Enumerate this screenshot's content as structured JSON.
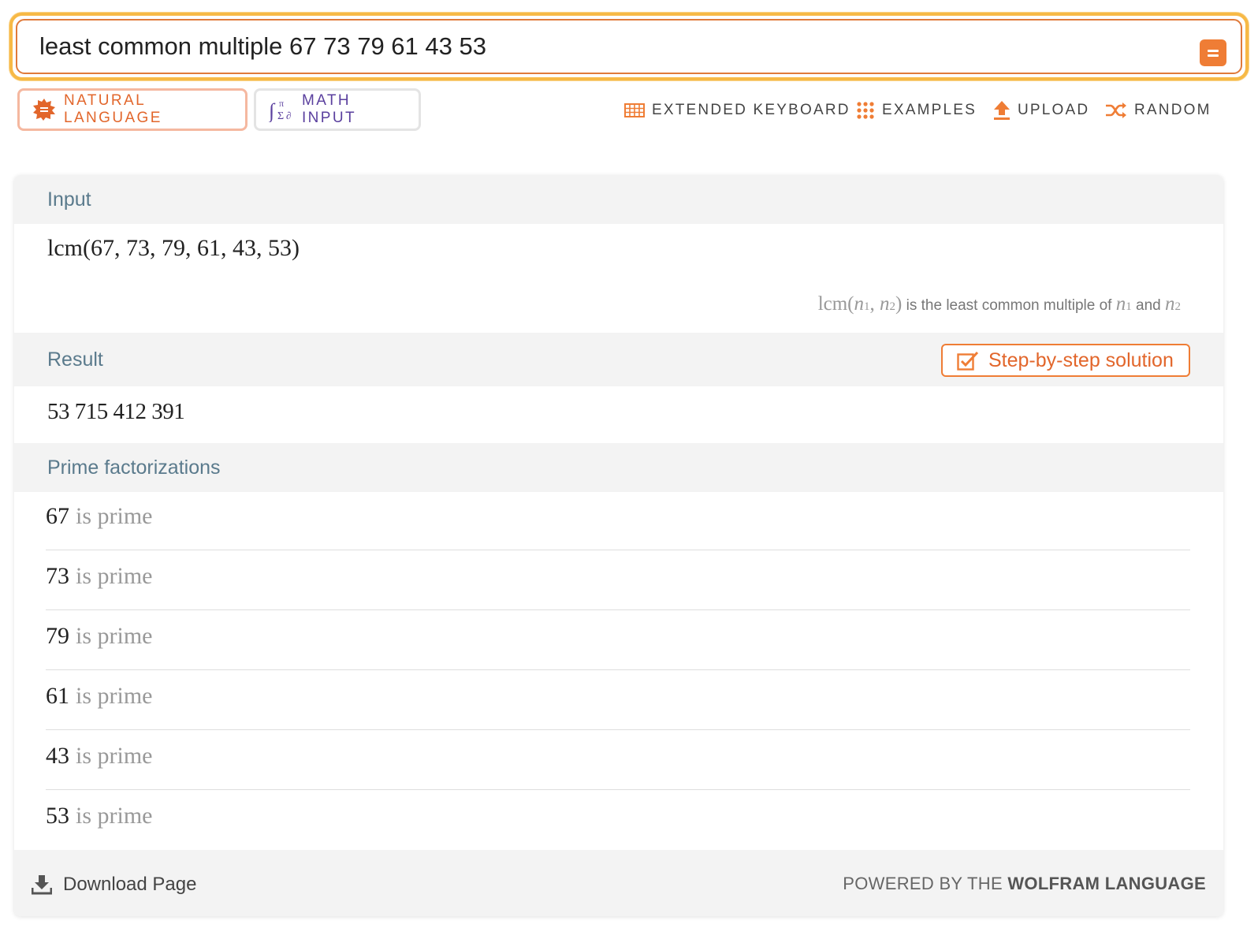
{
  "search": {
    "query": "least common multiple 67 73 79 61 43 53",
    "go_icon": "equals-icon"
  },
  "modes": {
    "natural_language": "NATURAL LANGUAGE",
    "math_input": "MATH INPUT"
  },
  "toolbar": {
    "extended_keyboard": "EXTENDED KEYBOARD",
    "examples": "EXAMPLES",
    "upload": "UPLOAD",
    "random": "RANDOM"
  },
  "pods": {
    "input": {
      "title": "Input",
      "expression": "lcm(67, 73, 79, 61, 43, 53)",
      "note": {
        "fn": "lcm(",
        "n1": "n",
        "sub1": "1",
        "comma": ", ",
        "n2": "n",
        "sub2": "2",
        "close": ")",
        "text": " is the least common multiple of ",
        "and": " and "
      }
    },
    "result": {
      "title": "Result",
      "step_button": "Step-by-step solution",
      "value": "53 715 412 391"
    },
    "prime_factorizations": {
      "title": "Prime factorizations",
      "suffix": "is prime",
      "rows": [
        "67",
        "73",
        "79",
        "61",
        "43",
        "53"
      ]
    }
  },
  "footer": {
    "download": "Download Page",
    "powered_prefix": "POWERED BY THE ",
    "powered_brand": "WOLFRAM LANGUAGE"
  },
  "colors": {
    "accent_orange": "#ef7d35",
    "search_outline": "#f7b946",
    "math_input_purple": "#5a3f9e",
    "pod_title": "#5a7a8c"
  }
}
